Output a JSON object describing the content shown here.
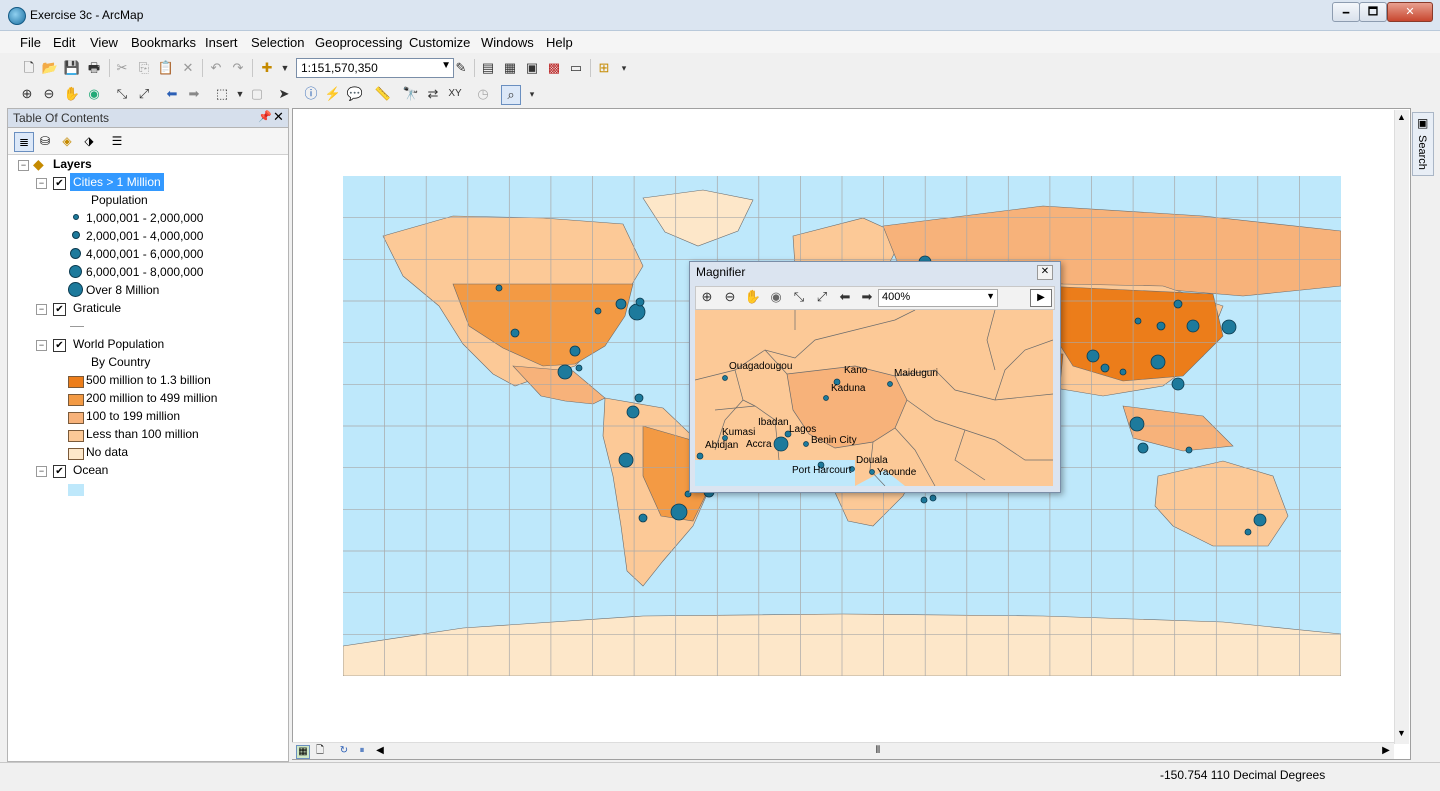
{
  "window": {
    "title": "Exercise 3c - ArcMap",
    "min": "🗕",
    "max": "🗖",
    "close": "✕"
  },
  "menu": [
    "File",
    "Edit",
    "View",
    "Bookmarks",
    "Insert",
    "Selection",
    "Geoprocessing",
    "Customize",
    "Windows",
    "Help"
  ],
  "toolbar": {
    "scale": "1:151,570,350"
  },
  "toc": {
    "title": "Table Of Contents",
    "root": "Layers",
    "layers": [
      {
        "name": "Cities > 1 Million",
        "selected": true,
        "heading": "Population",
        "classes": [
          "1,000,001 - 2,000,000",
          "2,000,001 - 4,000,000",
          "4,000,001 - 6,000,000",
          "6,000,001 - 8,000,000",
          "Over 8 Million"
        ]
      },
      {
        "name": "Graticule"
      },
      {
        "name": "World Population",
        "heading": "By Country",
        "classes": [
          "500 million to 1.3 billion",
          "200 million to 499 million",
          "100 to 199 million",
          "Less than 100 million",
          "No data"
        ]
      },
      {
        "name": "Ocean"
      }
    ]
  },
  "colors": {
    "ocean": "#bee8fb",
    "pop_500m_1_3b": "#ec7d1a",
    "pop_200m_499m": "#f39a44",
    "pop_100_199m": "#f7b27a",
    "pop_lt_100m": "#fcc997",
    "no_data": "#fde7c9",
    "city": "#1d7a9c"
  },
  "side_tab": "Search",
  "magnifier": {
    "title": "Magnifier",
    "zoom": "400%",
    "cities": [
      "Ouagadougou",
      "Kano",
      "Maiduguri",
      "Kaduna",
      "Ibadan",
      "Lagos",
      "Kumasi",
      "Abidjan",
      "Accra",
      "Benin City",
      "Douala",
      "Port Harcourt",
      "Yaounde"
    ]
  },
  "status": {
    "coords": "-150.754  110 Decimal Degrees"
  }
}
